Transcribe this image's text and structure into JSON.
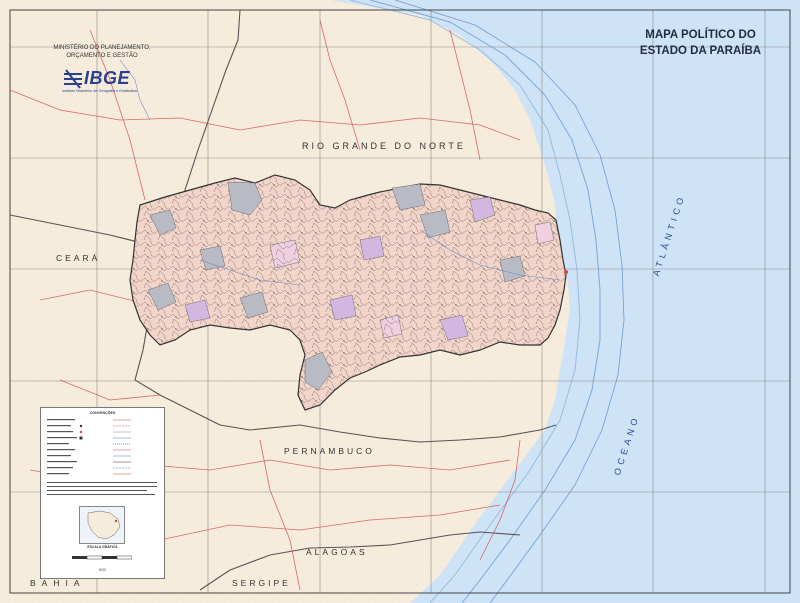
{
  "map": {
    "title_line1": "MAPA POLÍTICO DO",
    "title_line2": "ESTADO DA PARAÍBA",
    "ministry_line1": "MINISTÉRIO DO PLANEJAMENTO,",
    "ministry_line2": "ORÇAMENTO E GESTÃO",
    "logo_text": "IBGE",
    "logo_subtitle": "Instituto Brasileiro de Geografia e Estatística",
    "neighbor_states": [
      "RIO GRANDE DO NORTE",
      "CEARÁ",
      "PERNAMBUCO",
      "ALAGOAS",
      "SERGIPE",
      "BAHIA"
    ],
    "ocean_words": [
      "ATLÂNTICO",
      "OCEANO"
    ],
    "legend_title": "CONVENÇÕES",
    "legend_inset_title": "ESCALA GRÁFICA",
    "legend_credit": "IBGE",
    "colors": {
      "ocean": "#cfe3f7",
      "land": "#f6ecdc",
      "paraiba_fill": "#f3d4c8",
      "municipality_borders": "#4a4a4a",
      "roads": "#d2474a",
      "grid": "#8a8a8a",
      "state_border": "#555555",
      "highlight_gray": "#b8bac4",
      "highlight_purple": "#d3b7e0",
      "logo_blue": "#2b3f8e"
    },
    "icons": [
      "ibge-logo-icon",
      "north-arrow-icon",
      "brazil-inset-icon"
    ]
  }
}
